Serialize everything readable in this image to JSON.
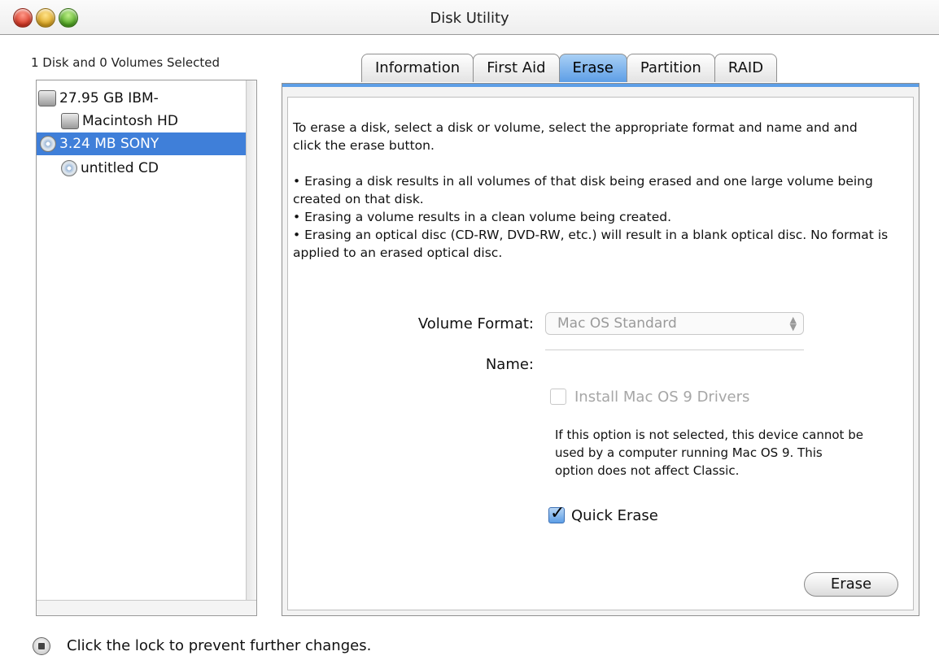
{
  "window": {
    "title": "Disk Utility",
    "controls": [
      "close",
      "minimize",
      "zoom"
    ]
  },
  "sidebar": {
    "selection_label": "1 Disk and 0 Volumes Selected",
    "items": [
      {
        "label": "27.95 GB IBM-",
        "icon": "hard-disk-icon",
        "selected": false
      },
      {
        "label": "Macintosh HD",
        "icon": "hard-disk-icon",
        "selected": false
      },
      {
        "label": "3.24 MB SONY",
        "icon": "cd-icon",
        "selected": true
      },
      {
        "label": "untitled CD",
        "icon": "cd-icon",
        "selected": false
      }
    ]
  },
  "tabs": [
    {
      "label": "Information",
      "active": false
    },
    {
      "label": "First Aid",
      "active": false
    },
    {
      "label": "Erase",
      "active": true
    },
    {
      "label": "Partition",
      "active": false
    },
    {
      "label": "RAID",
      "active": false
    }
  ],
  "erase": {
    "intro": "To erase a disk, select a disk or volume, select the appropriate format and name and and click the erase button.",
    "bullets": [
      "• Erasing a disk results in all volumes of that disk being erased and one large volume being created on that disk.",
      "• Erasing a volume results in a clean volume being created.",
      "• Erasing an optical disc (CD-RW, DVD-RW, etc.) will result in a blank optical disc. No format is applied to an erased optical disc."
    ],
    "volume_format_label": "Volume Format:",
    "volume_format_value": "Mac OS Standard",
    "name_label": "Name:",
    "name_value": "",
    "os9_drivers_label": "Install Mac OS 9 Drivers",
    "os9_note": "If this option is not selected, this device cannot be used by a computer running Mac OS 9.  This option does not affect Classic.",
    "quick_erase_label": "Quick Erase",
    "erase_button": "Erase"
  },
  "footer": {
    "lock_text": "Click the lock to prevent further changes."
  },
  "colors": {
    "accent": "#3f7fd9",
    "tab_active": "#5d9ee6"
  }
}
